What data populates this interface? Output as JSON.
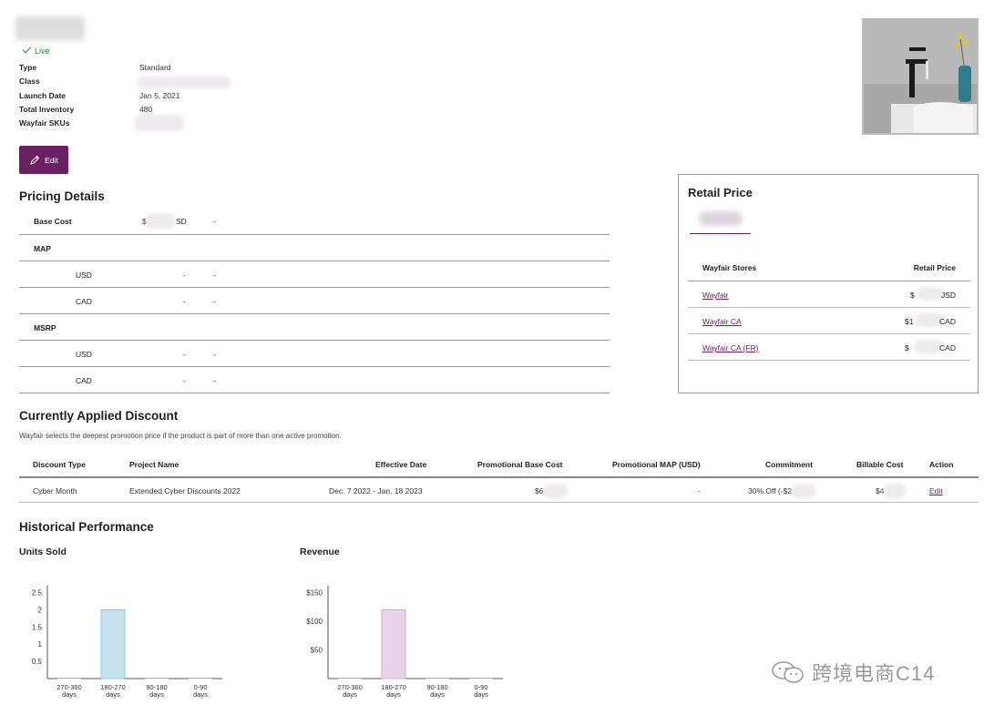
{
  "header": {
    "status": "Live",
    "meta": [
      {
        "label": "Type",
        "value": "Standard"
      },
      {
        "label": "Class",
        "value": ""
      },
      {
        "label": "Launch Date",
        "value": "Jan 5, 2021"
      },
      {
        "label": "Total Inventory",
        "value": "480"
      },
      {
        "label": "Wayfair SKUs",
        "value": ""
      }
    ],
    "edit_label": "Edit"
  },
  "pricing": {
    "title": "Pricing Details",
    "base_cost_label": "Base Cost",
    "base_cost_prefix": "$",
    "base_cost_suffix": "SD",
    "base_cost_dash": "-",
    "map_label": "MAP",
    "msrp_label": "MSRP",
    "usd_label": "USD",
    "cad_label": "CAD",
    "dash": "-"
  },
  "retail": {
    "title": "Retail Price",
    "col_store": "Wayfair Stores",
    "col_price": "Retail Price",
    "stores": [
      {
        "name": "Wayfair",
        "price_prefix": "$",
        "price_suffix": "JSD"
      },
      {
        "name": "Wayfair CA",
        "price_prefix": "$1",
        "price_suffix": "CAD"
      },
      {
        "name": "Wayfair CA (FR)",
        "price_prefix": "$",
        "price_suffix": "CAD"
      }
    ]
  },
  "discount": {
    "title": "Currently Applied Discount",
    "note": "Wayfair selects the deepest promotion price if the product is part of more than one active promotion.",
    "headers": {
      "type": "Discount Type",
      "project": "Project Name",
      "date": "Effective Date",
      "base": "Promotional Base Cost",
      "map": "Promotional MAP (USD)",
      "commit": "Commitment",
      "billable": "Billable Cost",
      "action": "Action"
    },
    "row": {
      "type": "Cyber Month",
      "project": "Extended Cyber Discounts 2022",
      "date": "Dec. 7 2022 - Jan. 18 2023",
      "base": "$6",
      "map": "-",
      "commit": "30% Off (-$2",
      "billable": "$4",
      "action": "Edit"
    }
  },
  "history": {
    "title": "Historical Performance"
  },
  "chart_data": [
    {
      "type": "bar",
      "title": "Units Sold",
      "categories": [
        "270-360 days",
        "180-270 days",
        "90-180 days",
        "0-90 days"
      ],
      "values": [
        0,
        2,
        0,
        0
      ],
      "yticks": [
        "0.5",
        "1",
        "1.5",
        "2",
        "2.5"
      ],
      "ylim": [
        0,
        2.7
      ],
      "color": "#c5e3ee",
      "stroke": "#8fc7db"
    },
    {
      "type": "bar",
      "title": "Revenue",
      "categories": [
        "270-360 days",
        "180-270 days",
        "90-180 days",
        "0-90 days"
      ],
      "values": [
        0,
        120,
        0,
        0
      ],
      "yticks": [
        "$50",
        "$100",
        "$150"
      ],
      "ylim": [
        0,
        162
      ],
      "color": "#e8d4e6",
      "stroke": "#d2aecd"
    }
  ],
  "watermark": {
    "text": "跨境电商C14"
  }
}
